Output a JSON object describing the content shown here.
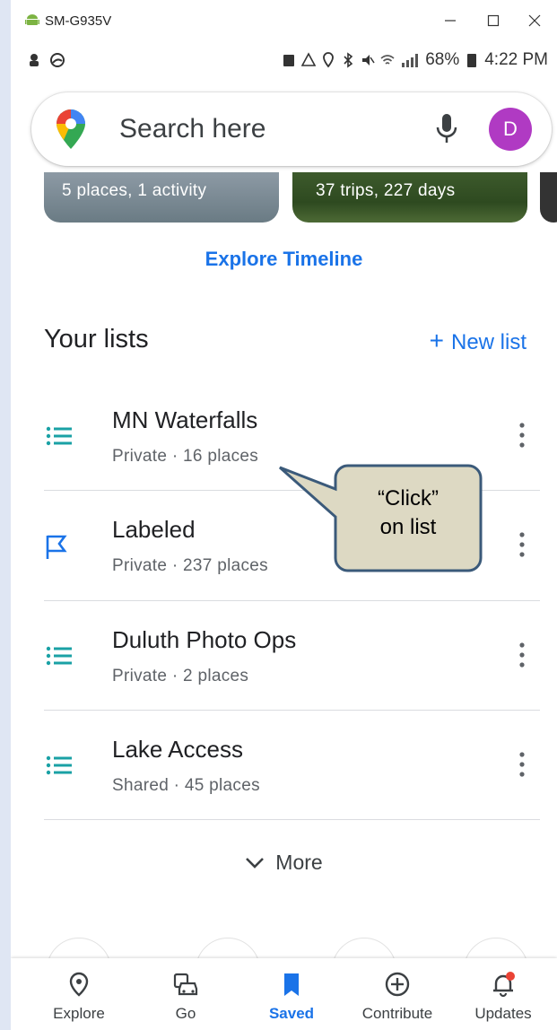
{
  "window": {
    "title": "SM-G935V"
  },
  "status": {
    "battery": "68%",
    "time": "4:22 PM"
  },
  "search": {
    "placeholder": "Search here",
    "avatar_letter": "D"
  },
  "cards": [
    {
      "text": "5 places,  1 activity"
    },
    {
      "text": "37 trips,  227 days"
    }
  ],
  "explore_timeline": "Explore Timeline",
  "lists_header": {
    "title": "Your lists",
    "new_list": "New list",
    "plus": "+"
  },
  "lists": [
    {
      "name": "MN Waterfalls",
      "meta": "Private · 16 places",
      "icon": "list-icon"
    },
    {
      "name": "Labeled",
      "meta": "Private · 237 places",
      "icon": "flag-icon"
    },
    {
      "name": "Duluth Photo Ops",
      "meta": "Private · 2 places",
      "icon": "list-icon"
    },
    {
      "name": "Lake Access",
      "meta": "Shared · 45 places",
      "icon": "list-icon"
    }
  ],
  "more": "More",
  "callout": {
    "line1": "“Click”",
    "line2": "on list"
  },
  "nav": [
    {
      "label": "Explore",
      "icon": "location-pin-icon"
    },
    {
      "label": "Go",
      "icon": "commute-icon"
    },
    {
      "label": "Saved",
      "icon": "bookmark-icon"
    },
    {
      "label": "Contribute",
      "icon": "add-circle-icon"
    },
    {
      "label": "Updates",
      "icon": "bell-icon"
    }
  ],
  "colors": {
    "accent": "#1a73e8",
    "list_icon": "#1aa1a5",
    "avatar": "#b03ac3",
    "callout_fill": "#ddd9c3",
    "callout_border": "#3b5a7a"
  }
}
